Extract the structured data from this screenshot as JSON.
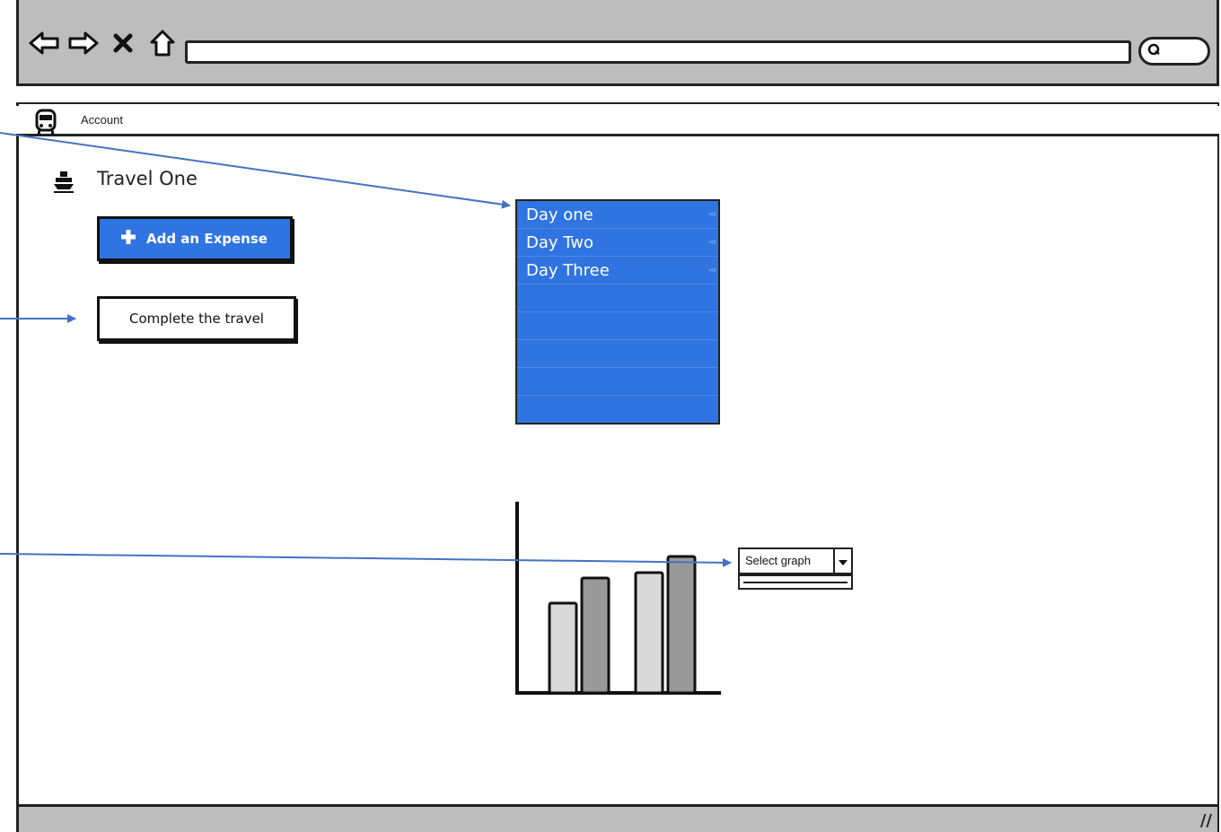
{
  "browser": {
    "nav_icons": [
      "back-arrow-icon",
      "forward-arrow-icon",
      "close-icon",
      "home-icon"
    ],
    "url": "",
    "search_icon": "search-icon"
  },
  "menubar": {
    "icon": "bus-icon",
    "account_label": "Account"
  },
  "page": {
    "title_icon": "ship-icon",
    "title": "Travel One"
  },
  "buttons": {
    "add_expense": "Add an Expense",
    "complete_travel": "Complete the travel"
  },
  "day_list": {
    "items": [
      "Day one",
      "Day Two",
      "Day Three"
    ]
  },
  "graph_select": {
    "selected": "Select graph"
  },
  "chart_data": {
    "type": "bar",
    "categories": [
      "",
      ""
    ],
    "series": [
      {
        "values": [
          50,
          67
        ]
      },
      {
        "values": [
          64,
          76
        ]
      }
    ],
    "ylim": [
      0,
      100
    ],
    "grid": false,
    "colors": [
      "#d9d9d9",
      "#999999"
    ]
  },
  "colors": {
    "accent": "#2f74e0",
    "chrome": "#bdbdbd",
    "annotation": "#4472c4"
  }
}
